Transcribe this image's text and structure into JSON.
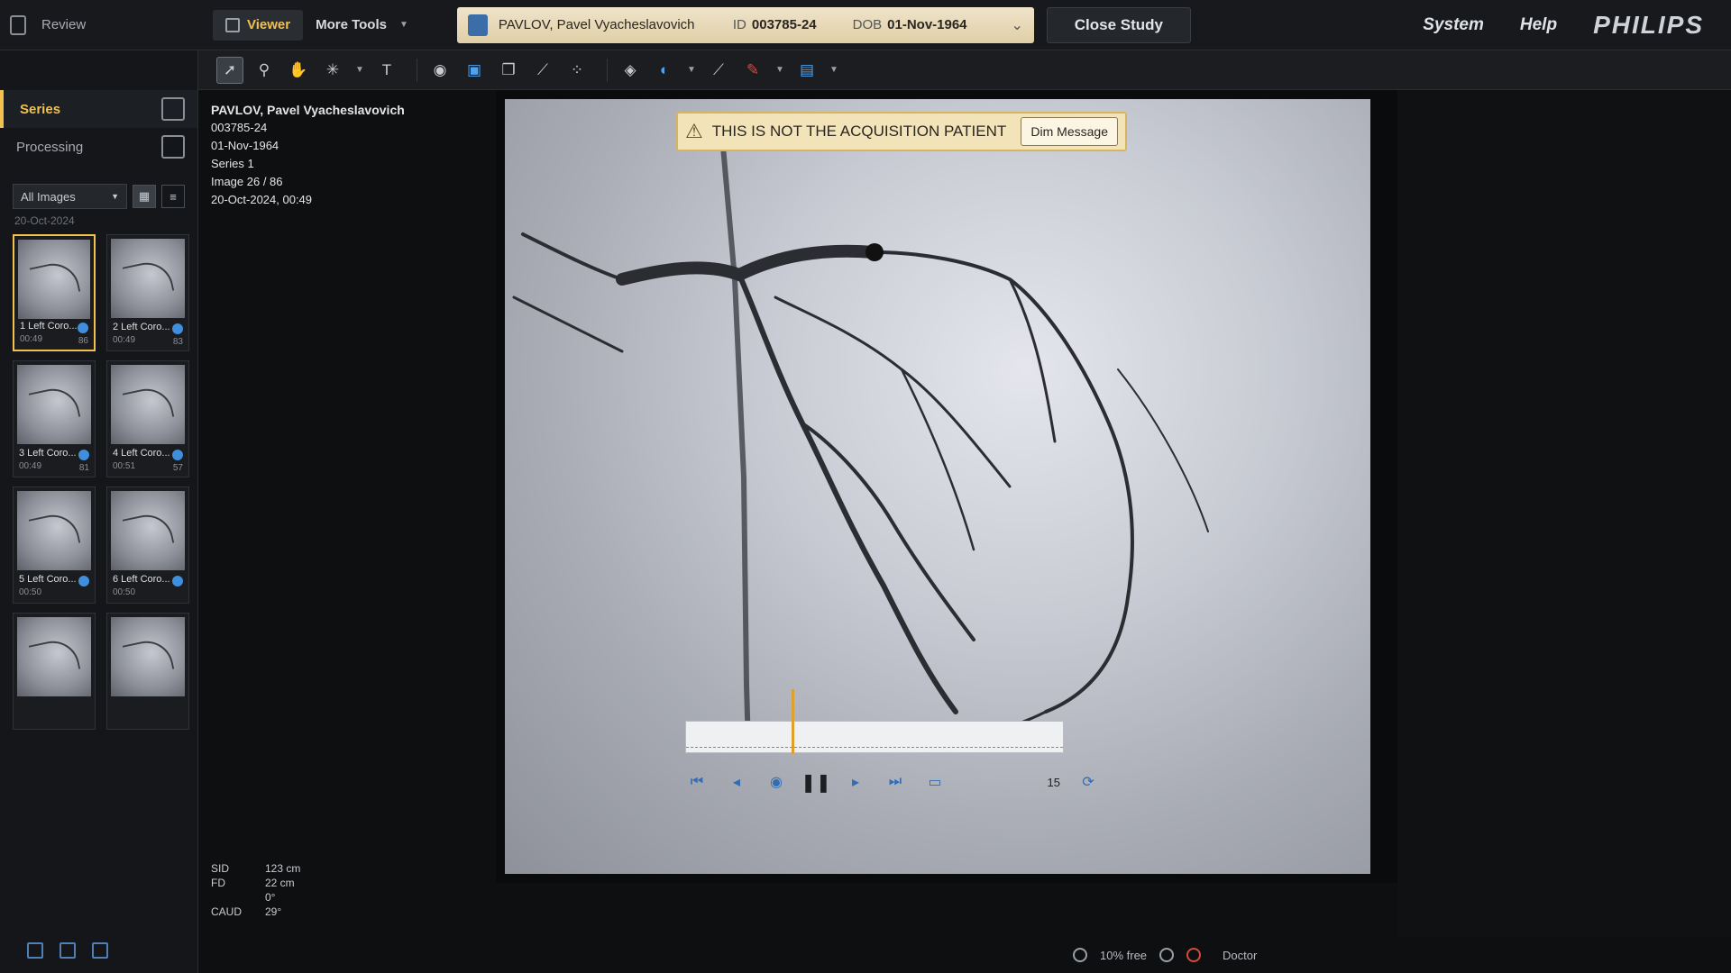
{
  "topbar": {
    "review_label": "Review",
    "tabs": [
      {
        "label": "Viewer",
        "active": true
      },
      {
        "label": "More Tools",
        "active": false
      }
    ],
    "patient": {
      "name": "PAVLOV, Pavel Vyacheslavovich",
      "id_label": "ID",
      "id_value": "003785-24",
      "dob_label": "DOB",
      "dob_value": "01-Nov-1964"
    },
    "close_study": "Close Study",
    "links": [
      "System",
      "Help"
    ],
    "brand": "PHILIPS"
  },
  "toolbar": {
    "icons": [
      "select-icon",
      "zoom-icon",
      "pan-icon",
      "contrast-icon",
      "text-icon",
      "snapshot-icon",
      "overlay-icon",
      "copy-icon",
      "ruler-icon",
      "grid-icon",
      "layers-icon",
      "shutter-icon",
      "measure-icon",
      "marker-icon",
      "display-icon"
    ]
  },
  "sidebar": {
    "items": [
      {
        "label": "Series",
        "active": true
      },
      {
        "label": "Processing",
        "active": false
      }
    ],
    "filter": "All Images",
    "date": "20-Oct-2024",
    "thumbnails": [
      {
        "caption": "1 Left Coro...",
        "time": "00:49",
        "count": "86",
        "selected": true
      },
      {
        "caption": "2 Left Coro...",
        "time": "00:49",
        "count": "83",
        "selected": false
      },
      {
        "caption": "3 Left Coro...",
        "time": "00:49",
        "count": "81",
        "selected": false
      },
      {
        "caption": "4 Left Coro...",
        "time": "00:51",
        "count": "57",
        "selected": false
      },
      {
        "caption": "5 Left Coro...",
        "time": "00:50",
        "count": "",
        "selected": false
      },
      {
        "caption": "6 Left Coro...",
        "time": "00:50",
        "count": "",
        "selected": false
      },
      {
        "caption": "",
        "time": "",
        "count": "",
        "selected": false
      },
      {
        "caption": "",
        "time": "",
        "count": "",
        "selected": false
      }
    ]
  },
  "info": {
    "name": "PAVLOV, Pavel Vyacheslavovich",
    "id": "003785-24",
    "dob": "01-Nov-1964",
    "series": "Series 1",
    "image": "Image 26 / 86",
    "datetime": "20-Oct-2024, 00:49",
    "sid_label": "SID",
    "sid_value": "123 cm",
    "fd_label": "FD",
    "fd_value": "22 cm",
    "angle1": "0°",
    "caud_label": "CAUD",
    "caud_value": "29°"
  },
  "viewer": {
    "warning": "THIS IS NOT THE ACQUISITION PATIENT",
    "dim_button": "Dim Message",
    "fps": "15",
    "playhead_fraction": 0.28
  },
  "status": {
    "disk": "10% free",
    "user": "Doctor"
  },
  "colors": {
    "accent": "#f2c14e",
    "banner": "#efe3c9",
    "link_blue": "#3f8fdc"
  }
}
